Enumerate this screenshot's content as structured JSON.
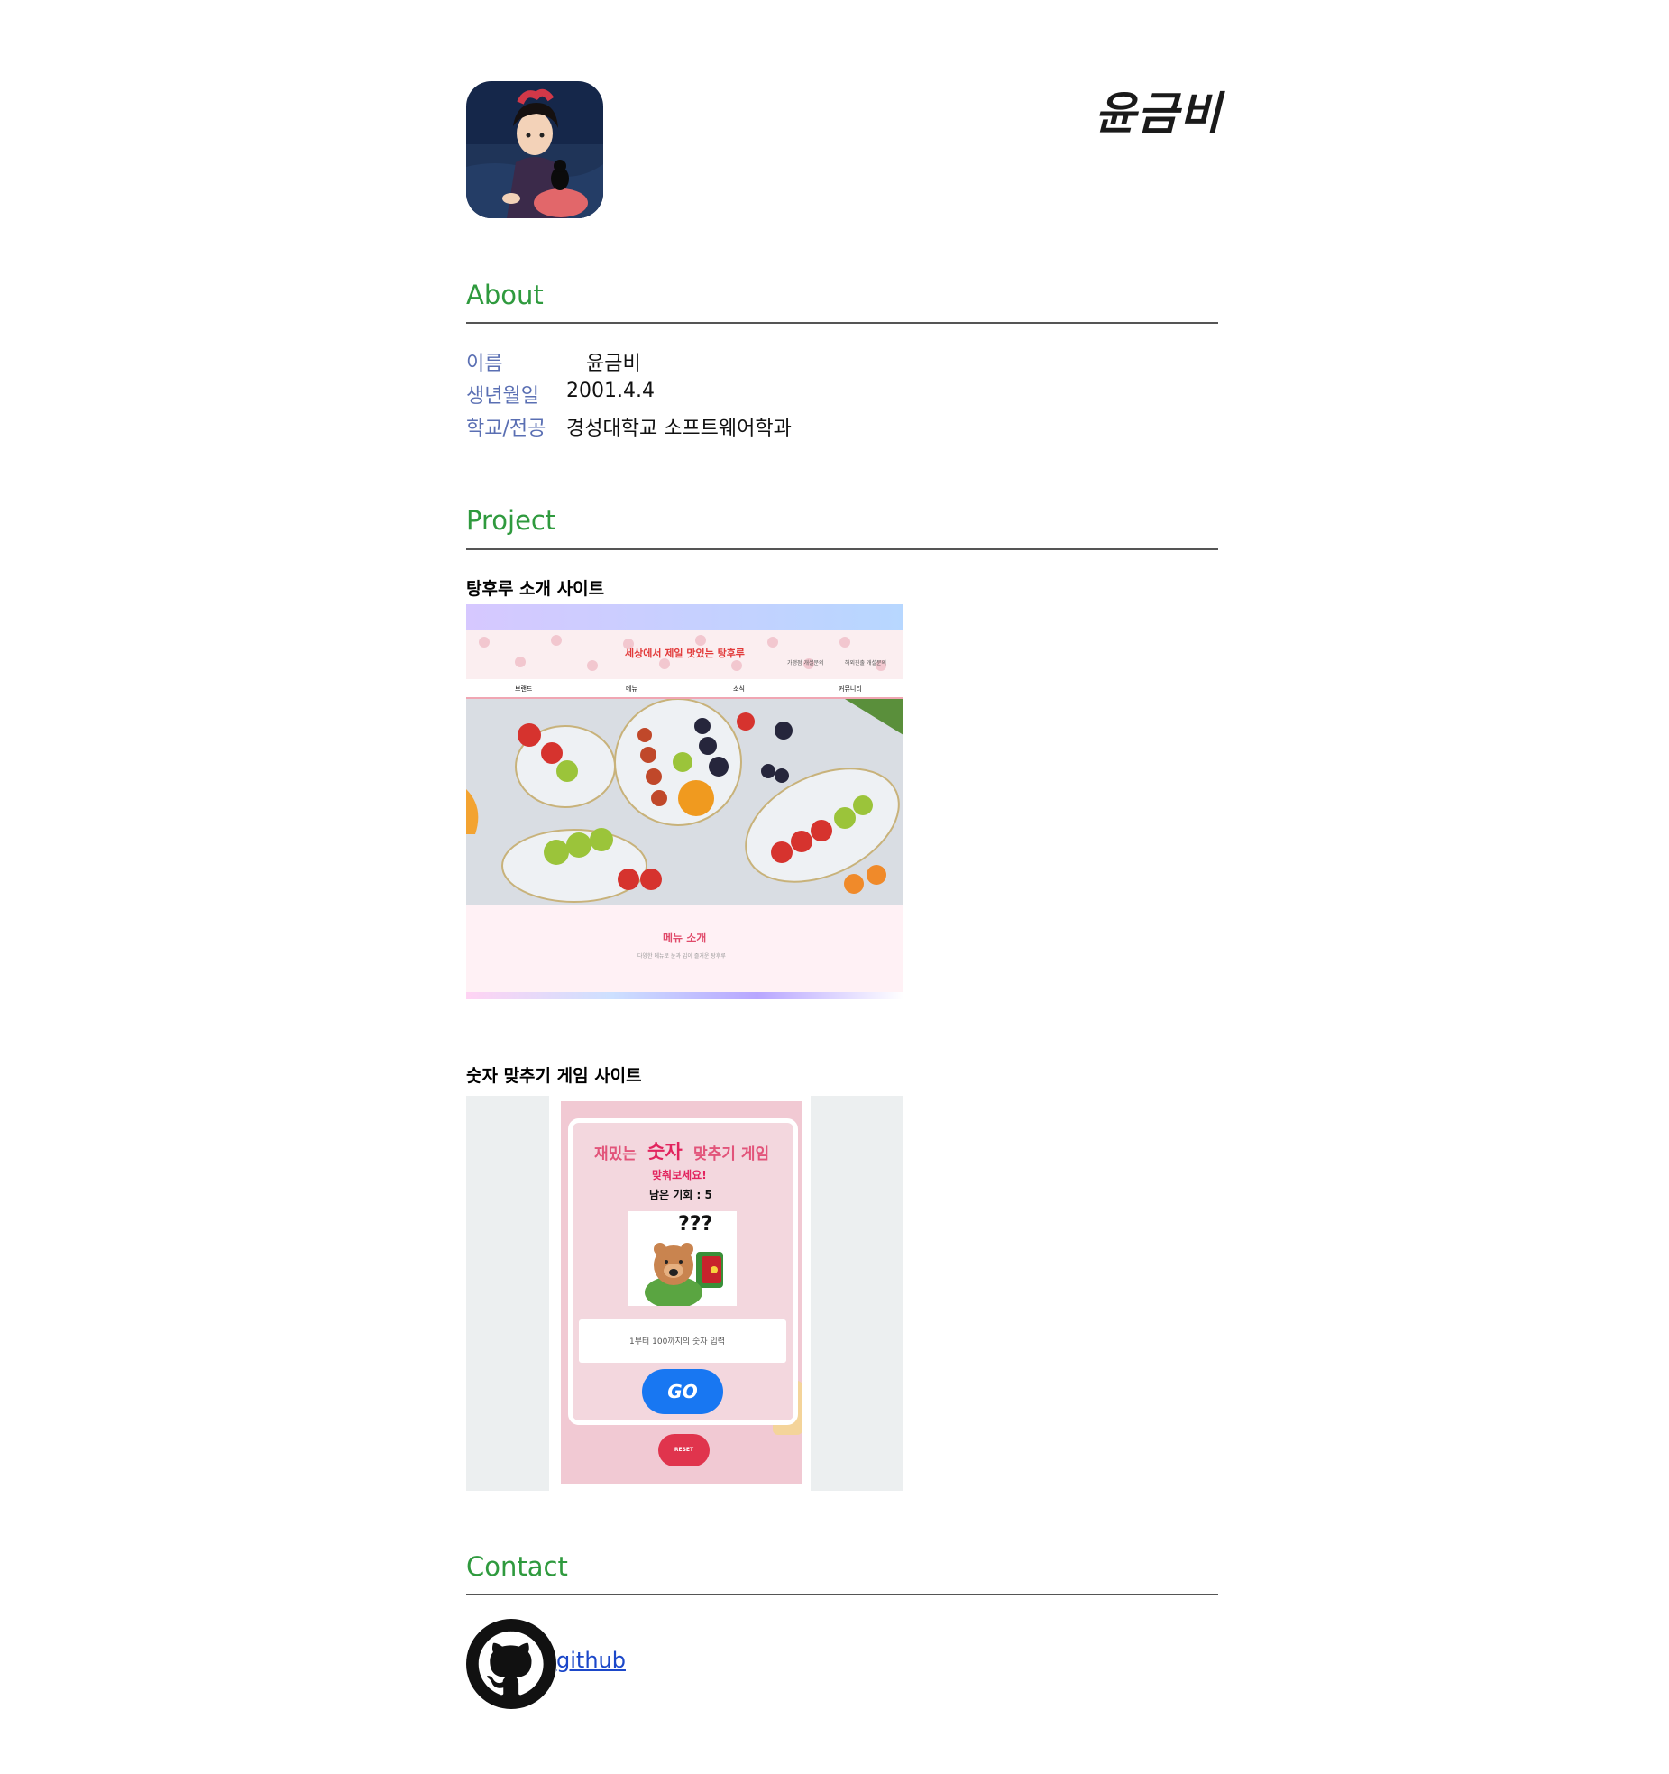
{
  "header": {
    "name": "윤금비"
  },
  "about": {
    "title": "About",
    "rows": [
      {
        "key": "이름",
        "value": "윤금비"
      },
      {
        "key": "생년월일",
        "value": "2001.4.4"
      },
      {
        "key": "학교/전공",
        "value": "경성대학교 소프트웨어학과"
      }
    ]
  },
  "project": {
    "title": "Project",
    "items": [
      {
        "title": "탕후루 소개 사이트",
        "shot": {
          "banner": "세상에서 제일 맛있는 탕후루",
          "top_links": [
            "가맹점 개설문의",
            "해외진출 개설문의"
          ],
          "nav": [
            "브랜드",
            "메뉴",
            "소식",
            "커뮤니티"
          ],
          "section_title": "메뉴 소개",
          "section_sub": "다양한 메뉴로 눈과 입이 즐거운 탕후루"
        }
      },
      {
        "title": "숫자 맞추기 게임 사이트",
        "shot": {
          "heading_a": "재밌는",
          "heading_b": "숫자",
          "heading_c": "맞추기 게임",
          "subheading": "맞춰보세요!",
          "chances": "남은 기회 : 5",
          "mystery": "???",
          "input_placeholder": "1부터 100까지의 숫자 입력",
          "go": "GO",
          "reset": "RESET"
        }
      }
    ]
  },
  "contact": {
    "title": "Contact",
    "github_label": "github"
  },
  "colors": {
    "section_title": "#2f9a3e",
    "about_key": "#5a6fb3",
    "link": "#1b47c9",
    "go_button": "#1877f2",
    "reset_button": "#e0344d"
  }
}
